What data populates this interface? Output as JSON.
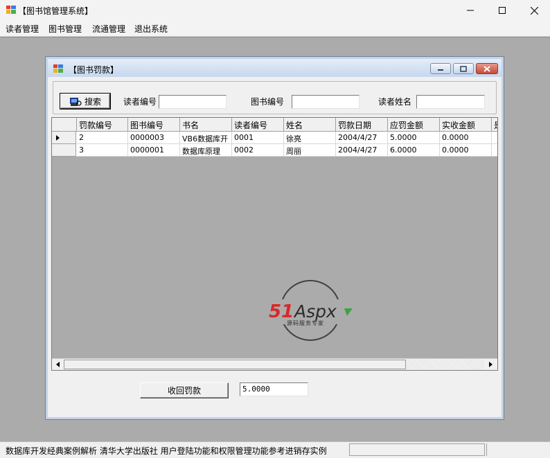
{
  "window": {
    "title": "【图书馆管理系统】",
    "icon": "app-icon"
  },
  "menu": [
    "读者管理",
    "图书管理",
    "流通管理",
    "退出系统"
  ],
  "child": {
    "title": "【图书罚款】",
    "search_button": "搜索",
    "labels": {
      "reader_id": "读者编号",
      "book_id": "图书编号",
      "reader_name": "读者姓名"
    },
    "inputs": {
      "reader_id": "",
      "book_id": "",
      "reader_name": ""
    },
    "grid": {
      "headers": [
        "罚款编号",
        "图书编号",
        "书名",
        "读者编号",
        "姓名",
        "罚款日期",
        "应罚金额",
        "实收金额",
        "是"
      ],
      "rows": [
        [
          "2",
          "0000003",
          "VB6数据库开",
          "0001",
          "徐亮",
          "2004/4/27",
          "5.0000",
          "0.0000"
        ],
        [
          "3",
          "0000001",
          "数据库原理",
          "0002",
          "周丽",
          "2004/4/27",
          "6.0000",
          "0.0000"
        ]
      ]
    },
    "recover_button": "收回罚款",
    "amount_value": "5.0000"
  },
  "watermark": {
    "brand_51": "51",
    "brand_aspx": "Aspx",
    "tagline": "源码服务专家"
  },
  "statusbar": {
    "text": "数据库开发经典案例解析   清华大学出版社   用户登陆功能和权限管理功能参考进销存实例"
  },
  "colors": {
    "mdi_bg": "#ababab",
    "child_title_gradient": "#c6d7ee",
    "close_red": "#c54a32",
    "brand_red": "#d42a2a",
    "brand_green": "#43a047"
  }
}
